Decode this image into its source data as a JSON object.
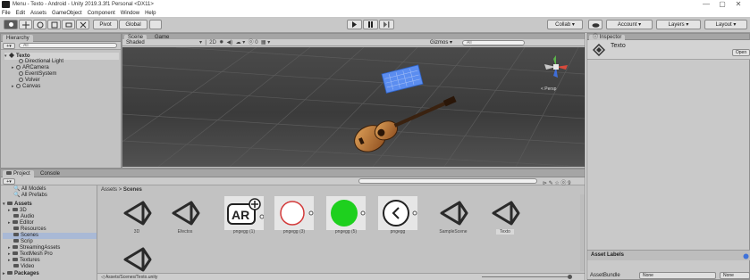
{
  "window": {
    "title": "Menu - Texto - Android - Unity 2019.3.3f1 Personal <DX11>",
    "controls": [
      "—",
      "▢",
      "✕"
    ]
  },
  "menu": [
    "File",
    "Edit",
    "Assets",
    "GameObject",
    "Component",
    "Window",
    "Help"
  ],
  "toolbar": {
    "pivot_label": "Pivot",
    "global_label": "Global",
    "collab_label": "Collab ▾",
    "account_label": "Account ▾",
    "layers_label": "Layers ▾",
    "layout_label": "Layout ▾"
  },
  "hierarchy": {
    "tab": "Hierarchy",
    "search_placeholder": "All",
    "scene_name": "Texto",
    "items": [
      "Directional Light",
      "ARCamera",
      "EventSystem",
      "Volver",
      "Canvas"
    ]
  },
  "scene": {
    "tab_scene": "Scene",
    "tab_game": "Game",
    "shading": "Shaded",
    "mode_2d": "2D",
    "gizmos": "Gizmos ▾",
    "search_placeholder": "All",
    "projection": "Persp"
  },
  "inspector": {
    "tab": "Inspector",
    "object_name": "Texto",
    "open_label": "Open",
    "asset_labels": "Asset Labels",
    "asset_bundle_label": "AssetBundle",
    "asset_bundle_value": "None",
    "asset_bundle_variant": "None"
  },
  "project": {
    "tab_project": "Project",
    "tab_console": "Console",
    "favorites": [
      "All Models",
      "All Prefabs"
    ],
    "assets_root": "Assets",
    "folders": [
      "3D",
      "Audio",
      "Editor",
      "Resources",
      "Scenes",
      "Scrip",
      "StreamingAssets",
      "TextMesh Pro",
      "Textures",
      "Video"
    ],
    "packages": "Packages",
    "breadcrumb_root": "Assets",
    "breadcrumb_sep": ">",
    "breadcrumb_leaf": "Scenes",
    "footer_path": "Assets/Scenes/Texto.unity",
    "assets": [
      "3D",
      "Efectos",
      "pngegg (1)",
      "pngegg (3)",
      "pngegg (5)",
      "pngegg",
      "SampleScene",
      "Texto"
    ]
  },
  "colors": {
    "toolbar_bg": "#c8c8c8",
    "panel_bg": "#c2c2c2",
    "scene_bg": "#444444",
    "selection": "#3f72d9",
    "green_circle": "#1ed01e",
    "red_ring": "#d33a3a"
  },
  "icons": [
    "unity-logo-icon",
    "hand-tool-icon",
    "move-tool-icon",
    "rotate-tool-icon",
    "scale-tool-icon",
    "rect-tool-icon",
    "transform-tool-icon",
    "play-icon",
    "pause-icon",
    "step-icon",
    "lock-icon",
    "unity-scene-icon",
    "folder-icon",
    "gameobject-icon",
    "cloud-icon",
    "gizmo-axis-icon"
  ]
}
